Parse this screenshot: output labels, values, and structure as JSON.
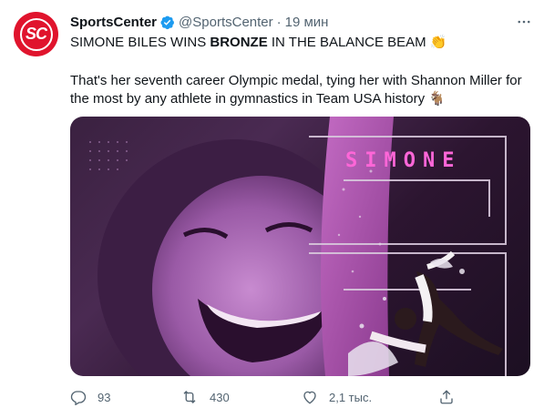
{
  "tweet": {
    "author_name": "SportsCenter",
    "handle": "@SportsCenter",
    "separator": "·",
    "time": "19 мин",
    "text_line1_prefix": "SIMONE BILES WINS ",
    "text_line1_bold": "BRONZE",
    "text_line1_suffix": " IN THE BALANCE BEAM 👏",
    "text_line2": "That's her seventh career Olympic medal, tying her with Shannon Miller for",
    "text_line3": "the most by any athlete in gymnastics in Team USA history 🐐",
    "avatar_text": "SC",
    "image_overlay_text": "SIMONE"
  },
  "actions": {
    "replies": "93",
    "retweets": "430",
    "likes": "2,1 тыс."
  },
  "icons": {
    "verified": "verified-badge-icon",
    "more": "more-icon",
    "reply": "reply-icon",
    "retweet": "retweet-icon",
    "like": "heart-icon",
    "share": "share-icon"
  },
  "colors": {
    "brand_red": "#e0142d",
    "verified_blue": "#1d9bf0",
    "text": "#0f1419",
    "secondary_text": "#536471",
    "image_accent": "#ff66d8"
  }
}
